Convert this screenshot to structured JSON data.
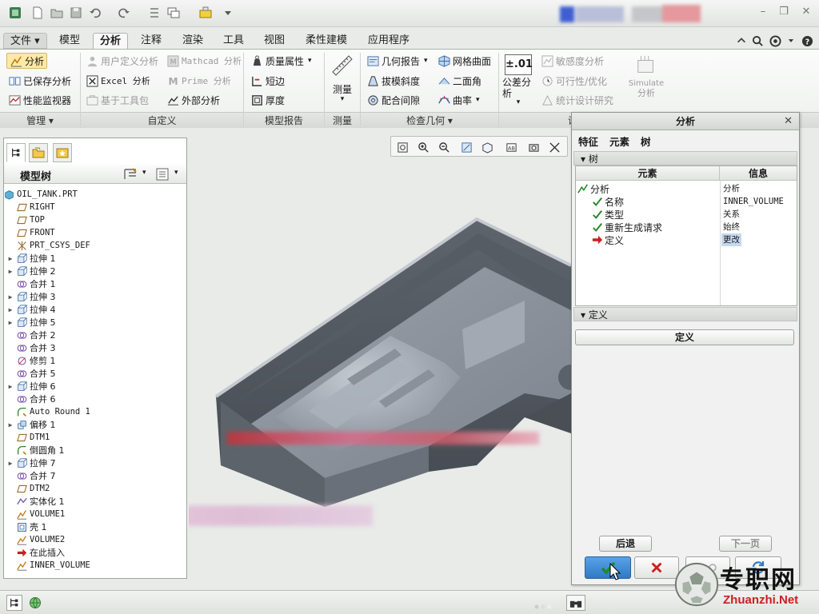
{
  "quick_access": {
    "icons": [
      "app-icon",
      "new-icon",
      "open-icon",
      "save-icon",
      "undo-icon",
      "redo-icon",
      "regenerate-icon",
      "windows-icon",
      "close-window-icon",
      "customize-icon"
    ]
  },
  "ribbon": {
    "tabs": [
      {
        "label": "文件"
      },
      {
        "label": "模型"
      },
      {
        "label": "分析"
      },
      {
        "label": "注释"
      },
      {
        "label": "渲染"
      },
      {
        "label": "工具"
      },
      {
        "label": "视图"
      },
      {
        "label": "柔性建模"
      },
      {
        "label": "应用程序"
      }
    ],
    "manage": {
      "analysis": "分析",
      "saved_analysis": "已保存分析",
      "performance_monitor": "性能监视器",
      "group": "管理"
    },
    "custom": {
      "user_defined": "用户定义分析",
      "mathcad": "Mathcad 分析",
      "excel": "Excel 分析",
      "prime": "Prime 分析",
      "toolkit": "基于工具包",
      "external": "外部分析",
      "group": "自定义"
    },
    "model_report": {
      "mass_props": "质量属性",
      "short_edge": "短边",
      "thickness": "厚度",
      "group": "模型报告"
    },
    "measure": {
      "label": "测量",
      "group": "测量"
    },
    "inspect": {
      "geometry_report": "几何报告",
      "mesh_surface": "网格曲面",
      "draft": "拔模斜度",
      "dihedral": "二面角",
      "clearance": "配合间隙",
      "curvature": "曲率",
      "group": "检查几何"
    },
    "design_study": {
      "tolerance_badge": "±.01",
      "tolerance_label": "公差分析",
      "sensitivity": "敏感度分析",
      "feasibility": "可行性/优化",
      "statistical": "统计设计研究",
      "simulate": "Simulate",
      "simulate_sub": "分析",
      "group": "设"
    }
  },
  "model_tree": {
    "title": "模型树",
    "items": [
      {
        "label": "OIL_TANK.PRT",
        "icon": "part-icon",
        "expand": false
      },
      {
        "label": "RIGHT",
        "icon": "datum-plane-icon",
        "expand": false
      },
      {
        "label": "TOP",
        "icon": "datum-plane-icon",
        "expand": false
      },
      {
        "label": "FRONT",
        "icon": "datum-plane-icon",
        "expand": false
      },
      {
        "label": "PRT_CSYS_DEF",
        "icon": "csys-icon",
        "expand": false
      },
      {
        "label": "拉伸 1",
        "icon": "extrude-icon",
        "expand": true
      },
      {
        "label": "拉伸 2",
        "icon": "extrude-icon",
        "expand": true
      },
      {
        "label": "合并 1",
        "icon": "merge-icon",
        "expand": false
      },
      {
        "label": "拉伸 3",
        "icon": "extrude-icon",
        "expand": true
      },
      {
        "label": "拉伸 4",
        "icon": "extrude-icon",
        "expand": true
      },
      {
        "label": "拉伸 5",
        "icon": "extrude-icon",
        "expand": true
      },
      {
        "label": "合并 2",
        "icon": "merge-icon",
        "expand": false
      },
      {
        "label": "合并 3",
        "icon": "merge-icon",
        "expand": false
      },
      {
        "label": "修剪 1",
        "icon": "trim-icon",
        "expand": false
      },
      {
        "label": "合并 5",
        "icon": "merge-icon",
        "expand": false
      },
      {
        "label": "拉伸 6",
        "icon": "extrude-icon",
        "expand": true
      },
      {
        "label": "合并 6",
        "icon": "merge-icon",
        "expand": false
      },
      {
        "label": "Auto Round 1",
        "icon": "round-icon",
        "expand": false
      },
      {
        "label": "偏移 1",
        "icon": "offset-icon",
        "expand": true
      },
      {
        "label": "DTM1",
        "icon": "datum-plane-icon",
        "expand": false
      },
      {
        "label": "倒圆角 1",
        "icon": "round-icon",
        "expand": false
      },
      {
        "label": "拉伸 7",
        "icon": "extrude-icon",
        "expand": true
      },
      {
        "label": "合并 7",
        "icon": "merge-icon",
        "expand": false
      },
      {
        "label": "DTM2",
        "icon": "datum-plane-icon",
        "expand": false
      },
      {
        "label": "实体化 1",
        "icon": "solidify-icon",
        "expand": false
      },
      {
        "label": "VOLUME1",
        "icon": "analysis-icon",
        "expand": false
      },
      {
        "label": "壳 1",
        "icon": "shell-icon",
        "expand": false
      },
      {
        "label": "VOLUME2",
        "icon": "analysis-icon",
        "expand": false
      },
      {
        "label": "在此插入",
        "icon": "insert-arrow-icon",
        "expand": false
      },
      {
        "label": "INNER_VOLUME",
        "icon": "analysis-icon",
        "expand": false
      }
    ]
  },
  "dialog": {
    "title": "分析",
    "tabs": [
      "特征",
      "元素",
      "树"
    ],
    "tree_section": "树",
    "col_element": "元素",
    "col_info": "信息",
    "rows": [
      {
        "element": "分析",
        "info": "分析"
      },
      {
        "element": "名称",
        "info": "INNER_VOLUME"
      },
      {
        "element": "类型",
        "info": "关系"
      },
      {
        "element": "重新生成请求",
        "info": "始终"
      },
      {
        "element": "定义",
        "info": "更改"
      }
    ],
    "define_section": "定义",
    "define_button": "定义",
    "back_button": "后退",
    "next_button": "下一页"
  },
  "watermark": {
    "brand": "专职网",
    "url": "Zhuanzhi.Net"
  },
  "colors": {
    "accent_red": "#cc1f1f",
    "ok_green": "#1f8a2b",
    "selection_blue": "#c5d9f1",
    "model_gray": "#6e7580"
  }
}
